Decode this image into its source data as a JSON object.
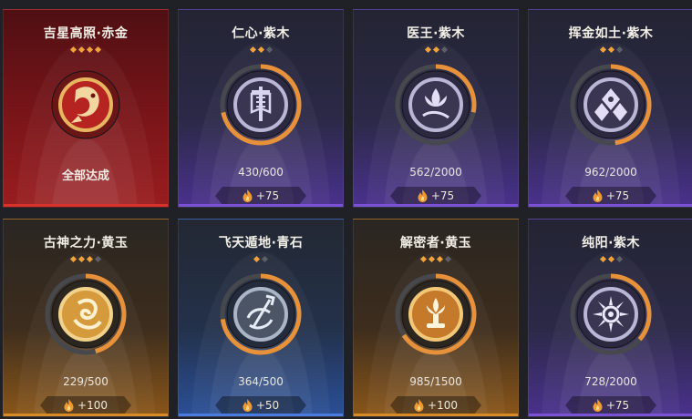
{
  "cards": [
    {
      "title": "吉星高照·赤金",
      "stars_total": 4,
      "stars_filled": 4,
      "status": "全部达成",
      "icon": "koi-fish-icon",
      "theme": "red",
      "complete": true
    },
    {
      "title": "仁心·紫木",
      "stars_total": 3,
      "stars_filled": 2,
      "progress": "430/600",
      "current": 430,
      "target": 600,
      "reward": "+75",
      "icon": "banner-flag-icon",
      "theme": "purple"
    },
    {
      "title": "医王·紫木",
      "stars_total": 3,
      "stars_filled": 2,
      "progress": "562/2000",
      "current": 562,
      "target": 2000,
      "reward": "+75",
      "icon": "lotus-hand-icon",
      "theme": "purple"
    },
    {
      "title": "挥金如土·紫木",
      "stars_total": 3,
      "stars_filled": 2,
      "progress": "962/2000",
      "current": 962,
      "target": 2000,
      "reward": "+75",
      "icon": "coin-pile-icon",
      "theme": "purple"
    },
    {
      "title": "古神之力·黄玉",
      "stars_total": 4,
      "stars_filled": 3,
      "progress": "229/500",
      "current": 229,
      "target": 500,
      "reward": "+100",
      "icon": "coiled-serpent-icon",
      "theme": "gold"
    },
    {
      "title": "飞天遁地·青石",
      "stars_total": 2,
      "stars_filled": 1,
      "progress": "364/500",
      "current": 364,
      "target": 500,
      "reward": "+50",
      "icon": "trident-swirl-icon",
      "theme": "blue"
    },
    {
      "title": "解密者·黄玉",
      "stars_total": 4,
      "stars_filled": 3,
      "progress": "985/1500",
      "current": 985,
      "target": 1500,
      "reward": "+100",
      "icon": "lotus-pedestal-icon",
      "theme": "gold"
    },
    {
      "title": "纯阳·紫木",
      "stars_total": 3,
      "stars_filled": 2,
      "progress": "728/2000",
      "current": 728,
      "target": 2000,
      "reward": "+75",
      "icon": "sun-wheel-icon",
      "theme": "purple"
    }
  ],
  "colors": {
    "accent_orange": "#e7923a",
    "star_filled": "#f0a23b",
    "star_empty": "#5e6067",
    "theme_red": "#8d1e1f",
    "theme_purple": "#4a2f8c",
    "theme_gold": "#7a4a14",
    "theme_blue": "#1f3e7a"
  }
}
